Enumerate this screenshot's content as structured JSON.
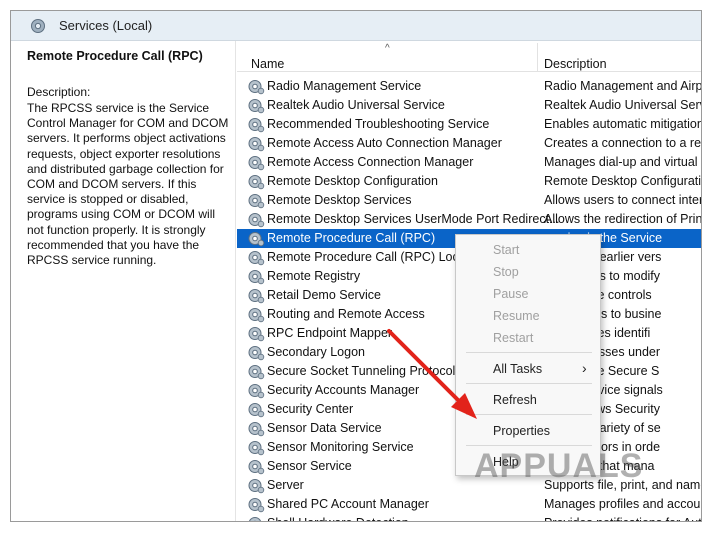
{
  "window": {
    "title": "Services (Local)"
  },
  "left_pane": {
    "selected_service": "Remote Procedure Call (RPC)",
    "description_label": "Description:",
    "description": "The RPCSS service is the Service Control Manager for COM and DCOM servers. It performs object activations requests, object exporter resolutions and distributed garbage collection for COM and DCOM servers. If this service is stopped or disabled, programs using COM or DCOM will not function properly. It is strongly recommended that you have the RPCSS service running."
  },
  "columns": {
    "name": "Name",
    "description": "Description"
  },
  "services": [
    {
      "name": "Radio Management Service",
      "description": "Radio Management and Airplane"
    },
    {
      "name": "Realtek Audio Universal Service",
      "description": "Realtek Audio Universal Service"
    },
    {
      "name": "Recommended Troubleshooting Service",
      "description": "Enables automatic mitigation fo"
    },
    {
      "name": "Remote Access Auto Connection Manager",
      "description": "Creates a connection to a remot"
    },
    {
      "name": "Remote Access Connection Manager",
      "description": "Manages dial-up and virtual priv"
    },
    {
      "name": "Remote Desktop Configuration",
      "description": "Remote Desktop Configuration s"
    },
    {
      "name": "Remote Desktop Services",
      "description": "Allows users to connect interacti"
    },
    {
      "name": "Remote Desktop Services UserMode Port Redirect...",
      "description": "Allows the redirection of Printers"
    },
    {
      "name": "Remote Procedure Call (RPC)",
      "description": "service is the Service"
    },
    {
      "name": "Remote Procedure Call (RPC) Locato",
      "description": "2003 and earlier vers"
    },
    {
      "name": "Remote Registry",
      "description": "mote users to modify"
    },
    {
      "name": "Retail Demo Service",
      "description": "mo service controls"
    },
    {
      "name": "Routing and Remote Access",
      "description": "ng services to busine"
    },
    {
      "name": "RPC Endpoint Mapper",
      "description": "C interfaces identifi"
    },
    {
      "name": "Secondary Logon",
      "description": "ting processes under"
    },
    {
      "name": "Secure Socket Tunneling Protocol Se",
      "description": "port for the Secure S"
    },
    {
      "name": "Security Accounts Manager",
      "description": "of this service signals"
    },
    {
      "name": "Security Center",
      "description": "C (Windows Security"
    },
    {
      "name": "Sensor Data Service",
      "description": "a from a variety of se"
    },
    {
      "name": "Sensor Monitoring Service",
      "description": "rious sensors in orde"
    },
    {
      "name": "Sensor Service",
      "description": "r sensors that mana"
    },
    {
      "name": "Server",
      "description": "Supports file, print, and named-p"
    },
    {
      "name": "Shared PC Account Manager",
      "description": "Manages profiles and accounts o"
    },
    {
      "name": "Shell Hardware Detection",
      "description": "Provides notifications for AutoPl"
    }
  ],
  "context_menu": {
    "start": "Start",
    "stop": "Stop",
    "pause": "Pause",
    "resume": "Resume",
    "restart": "Restart",
    "all_tasks": "All Tasks",
    "refresh": "Refresh",
    "properties": "Properties",
    "help": "Help"
  },
  "watermark": "APPUALS",
  "colors": {
    "selection": "#0a64c8",
    "arrow": "#e2231a"
  }
}
